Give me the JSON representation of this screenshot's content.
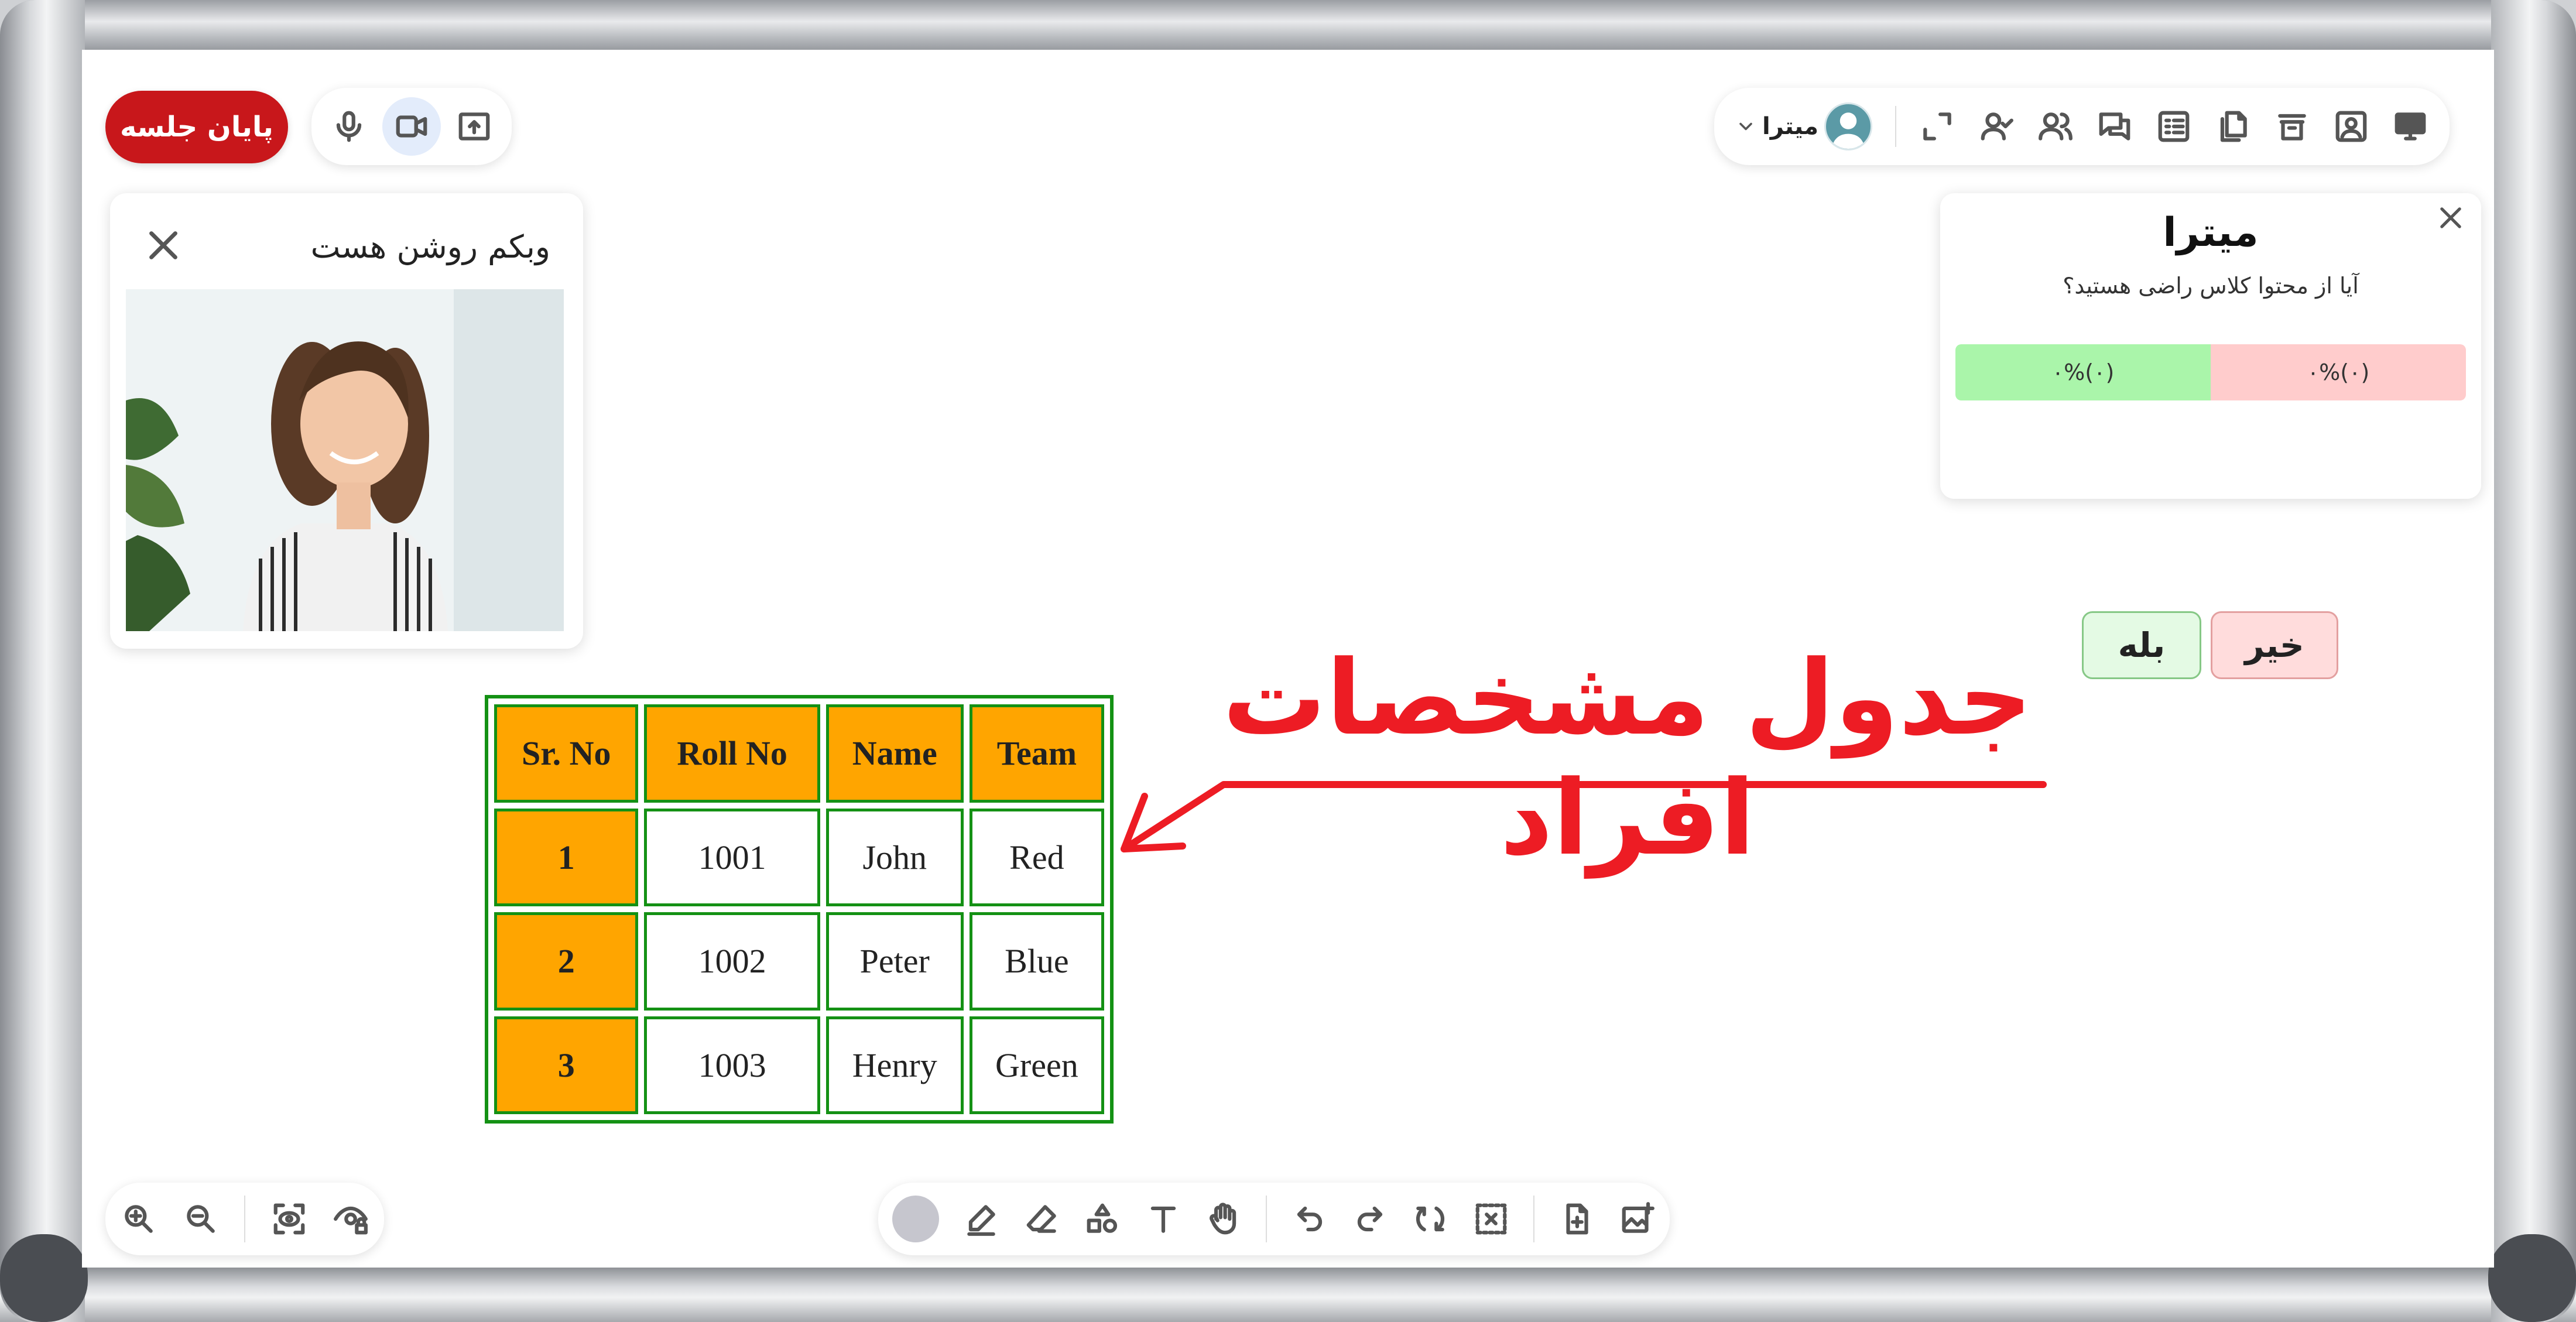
{
  "session": {
    "end_label": "پایان جلسه"
  },
  "user": {
    "name": "میترا"
  },
  "webcam": {
    "title": "وبکم روشن هست"
  },
  "poll": {
    "title": "میترا",
    "question": "آیا از محتوا کلاس راضی هستید؟",
    "yes_result": "۰%(۰)",
    "no_result": "۰%(۰)",
    "yes_label": "بله",
    "no_label": "خیر",
    "colors": {
      "yes": "#aaf5aa",
      "no": "#ffcccc"
    }
  },
  "board": {
    "heading": "جدول مشخصات افراد",
    "table": {
      "headers": [
        "Sr. No",
        "Roll No",
        "Name",
        "Team"
      ],
      "rows": [
        [
          "1",
          "1001",
          "John",
          "Red"
        ],
        [
          "2",
          "1002",
          "Peter",
          "Blue"
        ],
        [
          "3",
          "1003",
          "Henry",
          "Green"
        ]
      ]
    },
    "colors": {
      "header_fill": "#ffa500",
      "border": "#149114",
      "heading": "#ed1c24"
    }
  },
  "top_toolbar_icons": [
    "desktop-share-icon",
    "profile-icon",
    "archive-icon",
    "documents-icon",
    "checklist-icon",
    "chat-icon",
    "participants-icon",
    "attendance-icon",
    "fullscreen-icon",
    "user-avatar-icon",
    "chevron-down-icon"
  ],
  "media_icons": [
    "microphone-icon",
    "camera-icon",
    "upload-screen-icon"
  ],
  "drawing_tools": [
    "color-swatch",
    "pen-icon",
    "eraser-icon",
    "shapes-icon",
    "text-icon",
    "hand-icon",
    "undo-icon",
    "redo-icon",
    "refresh-icon",
    "clear-selection-icon",
    "add-page-icon",
    "add-image-icon"
  ],
  "zoom_tools": [
    "zoom-in-icon",
    "zoom-out-icon",
    "focus-view-icon",
    "eye-lock-icon"
  ]
}
